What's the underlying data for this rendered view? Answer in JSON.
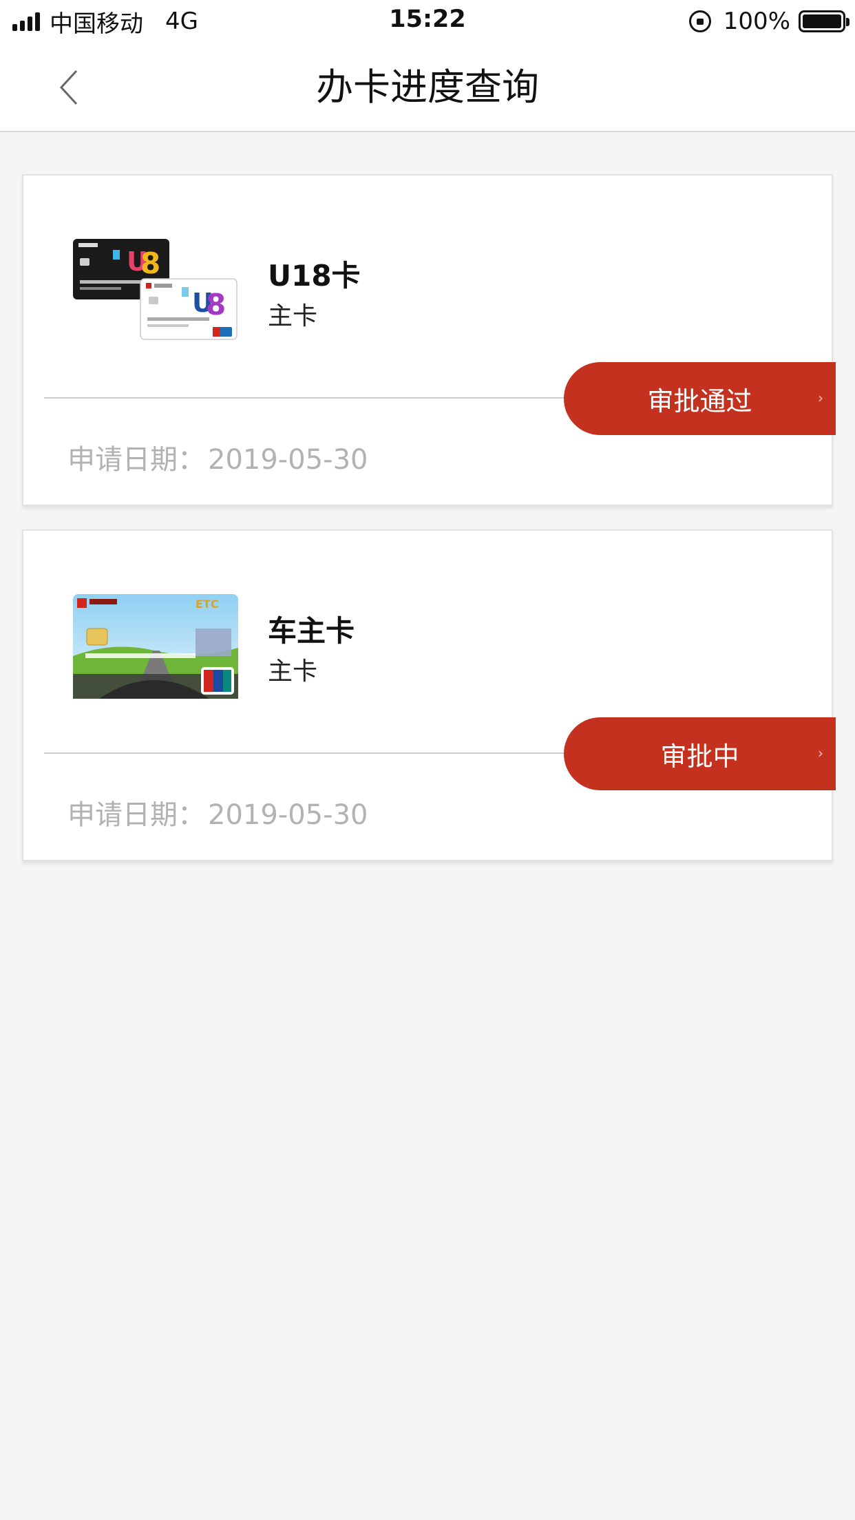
{
  "status_bar": {
    "carrier": "中国移动",
    "network": "4G",
    "time": "15:22",
    "battery": "100%"
  },
  "nav": {
    "title": "办卡进度查询",
    "back_icon": "chevron-left-icon"
  },
  "cards": [
    {
      "name": "U18卡",
      "type": "主卡",
      "status": "审批通过",
      "date_label": "申请日期：",
      "date": "2019-05-30",
      "image": "u18-card-image"
    },
    {
      "name": "车主卡",
      "type": "主卡",
      "status": "审批中",
      "date_label": "申请日期：",
      "date": "2019-05-30",
      "image": "car-owner-card-image"
    }
  ],
  "colors": {
    "accent": "#c4321f",
    "background": "#f5f5f5",
    "muted_text": "#b2b2b2"
  }
}
